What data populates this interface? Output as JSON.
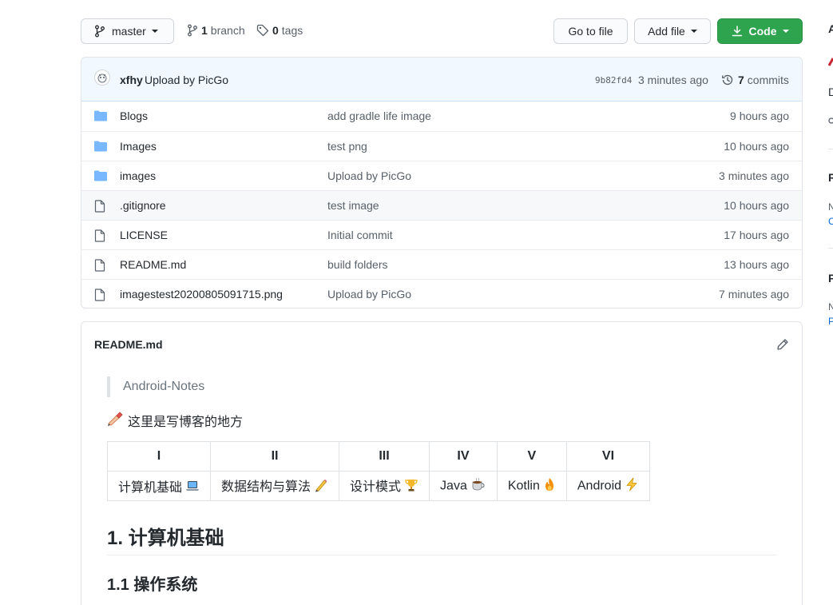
{
  "toolbar": {
    "branch_label": "master",
    "branch_count": "1",
    "branch_word": "branch",
    "tag_count": "0",
    "tag_word": "tags",
    "goto_label": "Go to file",
    "addfile_label": "Add file",
    "code_label": "Code"
  },
  "commit": {
    "author": "xfhy",
    "message": "Upload by PicGo",
    "sha": "9b82fd4",
    "time": "3 minutes ago",
    "count": "7",
    "count_word": "commits"
  },
  "files": [
    {
      "type": "folder",
      "name": "Blogs",
      "commit": "add gradle life image",
      "age": "9 hours ago"
    },
    {
      "type": "folder",
      "name": "Images",
      "commit": "test png",
      "age": "10 hours ago"
    },
    {
      "type": "folder",
      "name": "images",
      "commit": "Upload by PicGo",
      "age": "3 minutes ago"
    },
    {
      "type": "file",
      "name": ".gitignore",
      "commit": "test image",
      "age": "10 hours ago"
    },
    {
      "type": "file",
      "name": "LICENSE",
      "commit": "Initial commit",
      "age": "17 hours ago"
    },
    {
      "type": "file",
      "name": "README.md",
      "commit": "build folders",
      "age": "13 hours ago"
    },
    {
      "type": "file",
      "name": "imagestest20200805091715.png",
      "commit": "Upload by PicGo",
      "age": "7 minutes ago"
    }
  ],
  "colors": {
    "folder": "#79b8ff",
    "code_button": "#2ea44f",
    "commit_bar": "#f1f8ff"
  },
  "readme": {
    "title": "README.md",
    "quote": "Android-Notes",
    "intro": "这里是写博客的地方",
    "intro_icon": "writing-hand-icon",
    "table": {
      "headers": [
        "I",
        "II",
        "III",
        "IV",
        "V",
        "VI"
      ],
      "cells": [
        {
          "text": "计算机基础",
          "icon": "laptop-icon"
        },
        {
          "text": "数据结构与算法",
          "icon": "pencil-icon"
        },
        {
          "text": "设计模式",
          "icon": "trophy-icon"
        },
        {
          "text": "Java",
          "icon": "coffee-icon"
        },
        {
          "text": "Kotlin",
          "icon": "fire-icon"
        },
        {
          "text": "Android",
          "icon": "lightning-icon"
        }
      ]
    },
    "h1": "1. 计算机基础",
    "h2": "1.1 操作系统"
  },
  "right_edge": {
    "fragments": [
      "A",
      "D",
      "R",
      "N",
      "C",
      "P",
      "N",
      "P"
    ]
  }
}
